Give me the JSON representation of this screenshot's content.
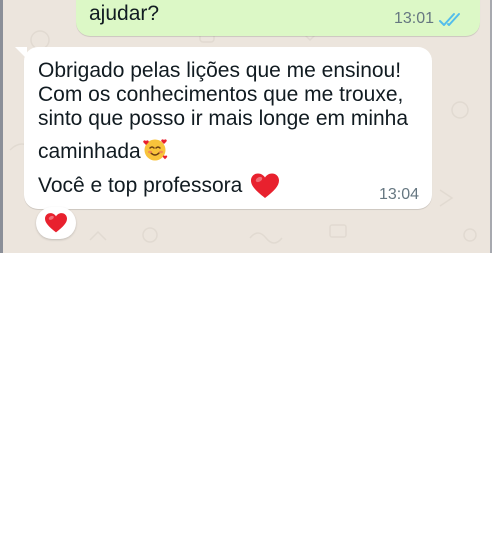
{
  "outgoing_message": {
    "text": "ajudar?",
    "time": "13:01",
    "status_icon": "double-check-read-icon",
    "colors": {
      "bubble": "#dcf8c6",
      "ticks": "#53bdeb"
    }
  },
  "incoming_message": {
    "lines": [
      "Obrigado pelas lições que me ensinou!",
      "Com os conhecimentos que me trouxe,",
      "sinto que posso ir mais longe em minha",
      "caminhada",
      "Você e top professora"
    ],
    "line4_emoji": "smiling-face-with-hearts-icon",
    "line5_emoji": "red-heart-icon",
    "time": "13:04",
    "colors": {
      "bubble": "#ffffff"
    }
  },
  "reaction": {
    "emoji": "red-heart-icon",
    "color": "#e8212e"
  },
  "colors": {
    "chat_background": "#ece5dd",
    "text": "#111b21",
    "timestamp": "#667781"
  }
}
